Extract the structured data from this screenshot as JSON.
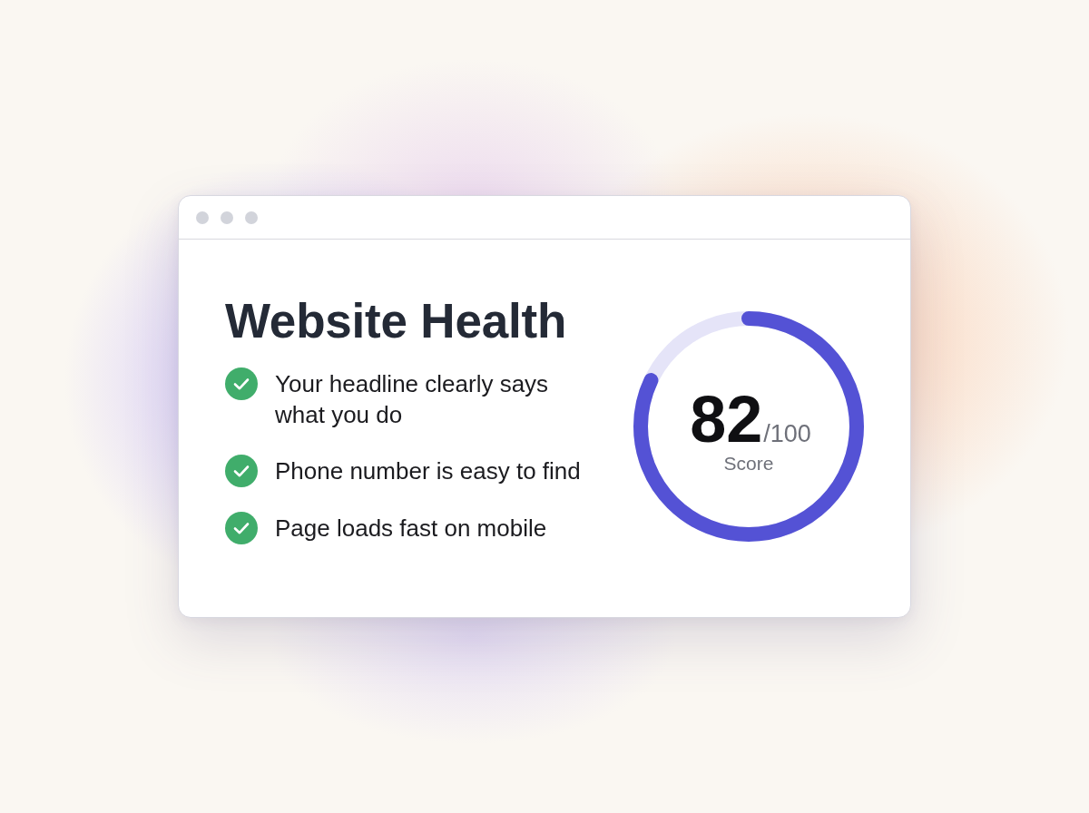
{
  "title": "Website Health",
  "checklist": [
    {
      "text": "Your headline clearly says what you do",
      "checked": true
    },
    {
      "text": "Phone number is easy to find",
      "checked": true
    },
    {
      "text": "Page loads fast on mobile",
      "checked": true
    }
  ],
  "score": {
    "value": "82",
    "out_of": "/100",
    "label": "Score",
    "level": 0.82
  }
}
